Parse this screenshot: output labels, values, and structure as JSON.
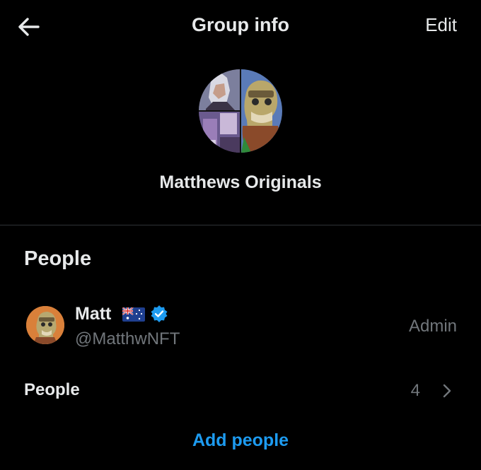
{
  "header": {
    "title": "Group info",
    "edit_label": "Edit",
    "back_icon": "arrow-left-icon"
  },
  "group": {
    "name": "Matthews Originals"
  },
  "section": {
    "title": "People"
  },
  "members": [
    {
      "name": "Matt",
      "flag": "australia-flag",
      "badge": "verified-badge-icon",
      "handle": "@MatthwNFT",
      "role": "Admin"
    }
  ],
  "people_row": {
    "label": "People",
    "count": "4"
  },
  "add_people_label": "Add people",
  "colors": {
    "background": "#000000",
    "text_primary": "#e7e9ea",
    "text_secondary": "#71767b",
    "accent": "#1d9bf0",
    "divider": "#2f3336"
  }
}
